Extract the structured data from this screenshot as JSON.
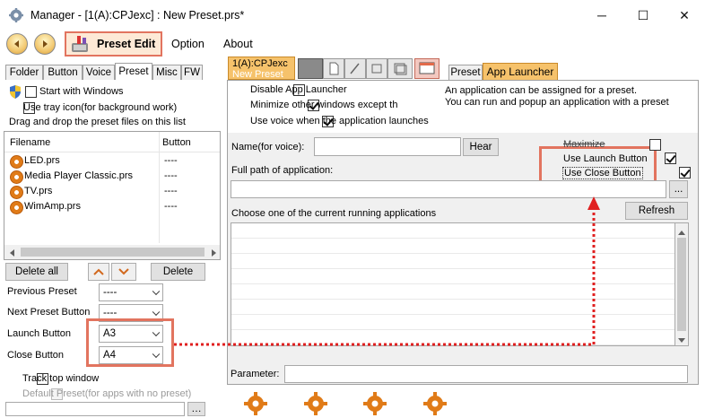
{
  "window": {
    "title": "Manager - [1(A):CPJexc] : New Preset.prs*",
    "minimize": "─",
    "maximize": "☐",
    "close": "✕"
  },
  "toolbar": {
    "preset_edit_label": "Preset Edit",
    "menu": [
      "Option",
      "About"
    ]
  },
  "left_tabs": [
    "Folder",
    "Button",
    "Voice",
    "Preset",
    "Misc",
    "FW"
  ],
  "left_tab_active": "Preset",
  "preset_panel": {
    "start_with_windows": "Start with Windows",
    "use_tray_icon": "Use tray icon(for background work)",
    "drag_drop_text": "Drag and drop the preset files on this list",
    "columns": [
      "Filename",
      "Button"
    ],
    "files": [
      {
        "name": "LED.prs",
        "button": "----"
      },
      {
        "name": "Media Player Classic.prs",
        "button": "----"
      },
      {
        "name": "TV.prs",
        "button": "----"
      },
      {
        "name": "WimAmp.prs",
        "button": "----"
      }
    ],
    "delete_all": "Delete all",
    "delete": "Delete",
    "previous_preset": {
      "label": "Previous Preset",
      "value": "----"
    },
    "next_preset_button": {
      "label": "Next Preset Button",
      "value": "----"
    },
    "launch_button": {
      "label": "Launch Button",
      "value": "A3"
    },
    "close_button": {
      "label": "Close Button",
      "value": "A4"
    },
    "track_top_window": "Track top window",
    "default_preset": "Default Preset(for apps with no preset)"
  },
  "top_tabs": {
    "device_tab_line1": "1(A):CPJexc",
    "device_tab_line2": "New Preset",
    "right_tabs": [
      "Preset",
      "App Launcher"
    ],
    "active_right_tab": "App Launcher"
  },
  "app_launcher": {
    "disable_app_launcher": "Disable App Launcher",
    "minimize_other": "Minimize other windows except th",
    "use_voice": "Use voice when the application launches",
    "info_line1": "An application can be assigned for a preset.",
    "info_line2": "You can run and popup an application with a preset",
    "name_for_voice_label": "Name(for voice):",
    "name_for_voice_value": "",
    "hear_button": "Hear",
    "maximize_label": "Maximize",
    "use_launch_button": "Use Launch Button",
    "use_close_button": "Use Close Button",
    "full_path_label": "Full path of application:",
    "full_path_value": "",
    "browse_button": "...",
    "refresh_button": "Refresh",
    "running_apps_label": "Choose one of the current running applications",
    "parameter_label": "Parameter:",
    "parameter_value": ""
  },
  "checkbox_states": {
    "start_with_windows": false,
    "use_tray_icon": false,
    "disable_app_launcher": false,
    "minimize_other": true,
    "use_voice": true,
    "maximize": false,
    "use_launch_button": true,
    "use_close_button": true,
    "track_top_window": false,
    "default_preset": false
  },
  "colors": {
    "highlight_box": "#e2745f",
    "dotted_arrow": "#e02020",
    "active_tab": "#f6c26b"
  }
}
